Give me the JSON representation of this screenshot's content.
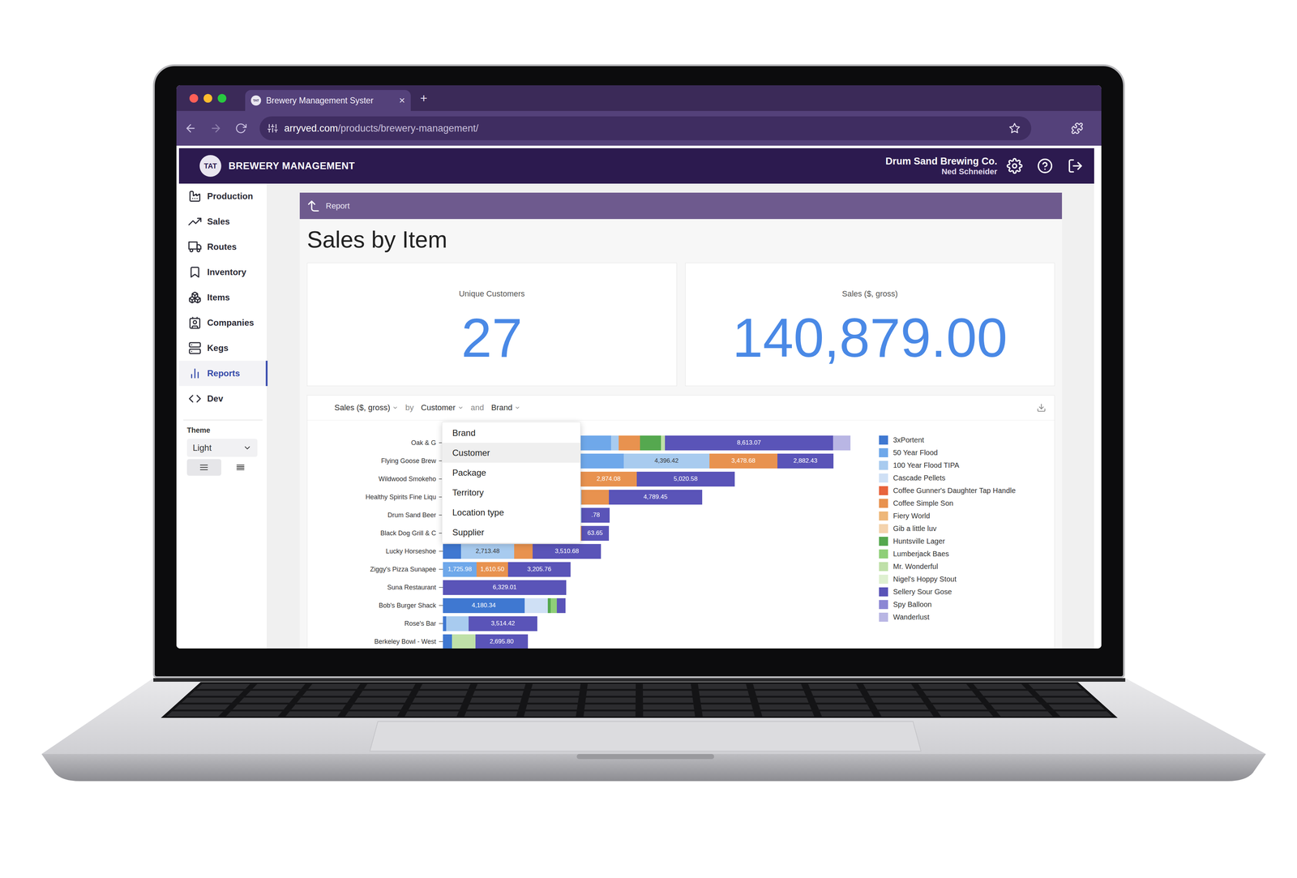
{
  "browser": {
    "tab": {
      "title": "Brewery Management Syster",
      "close": "×"
    },
    "new_tab": "+",
    "url": {
      "host": "arryved.com",
      "path": "/products/brewery-management/"
    }
  },
  "app": {
    "logo": "TAT",
    "name": "BREWERY MANAGEMENT",
    "company": "Drum Sand Brewing Co.",
    "user": "Ned Schneider"
  },
  "sidebar": {
    "items": [
      {
        "label": "Production",
        "selected": false
      },
      {
        "label": "Sales",
        "selected": false
      },
      {
        "label": "Routes",
        "selected": false
      },
      {
        "label": "Inventory",
        "selected": false
      },
      {
        "label": "Items",
        "selected": false
      },
      {
        "label": "Companies",
        "selected": false
      },
      {
        "label": "Kegs",
        "selected": false
      },
      {
        "label": "Reports",
        "selected": true
      },
      {
        "label": "Dev",
        "selected": false
      }
    ],
    "theme": {
      "label": "Theme",
      "value": "Light",
      "density": [
        {
          "kind": "comfortable",
          "selected": true
        },
        {
          "kind": "compact",
          "selected": false
        }
      ]
    }
  },
  "report": {
    "breadcrumb": "Report",
    "title": "Sales by Item",
    "stats": [
      {
        "label": "Unique Customers",
        "value": "27"
      },
      {
        "label": "Sales ($, gross)",
        "value": "140,879.00"
      }
    ]
  },
  "chart": {
    "toolbar": {
      "metric": "Sales ($, gross)",
      "by": "by",
      "group": "Customer",
      "and": "and",
      "subgroup": "Brand"
    },
    "menu": {
      "open": true,
      "options": [
        {
          "label": "Brand",
          "selected": false
        },
        {
          "label": "Customer",
          "selected": true
        },
        {
          "label": "Package",
          "selected": false
        },
        {
          "label": "Territory",
          "selected": false
        },
        {
          "label": "Location type",
          "selected": false
        },
        {
          "label": "Supplier",
          "selected": false
        }
      ]
    },
    "categories": [
      "Oak & G",
      "Flying Goose Brew",
      "Wildwood Smokeho",
      "Healthy Spirits Fine Liqu",
      "Drum Sand Beer",
      "Black Dog Grill & C",
      "Lucky Horseshoe",
      "Ziggy's Pizza Sunapee",
      "Suna Restaurant",
      "Bob's Burger Shack",
      "Rose's Bar",
      "Berkeley Bowl - West"
    ],
    "series": [
      {
        "name": "3xPortent",
        "color": "#3f78d1",
        "values": [
          4335,
          3060,
          2455,
          3000,
          2200,
          3100,
          935,
          0,
          0,
          4180.34,
          170,
          470
        ],
        "labels": [
          "",
          "",
          "",
          "",
          "",
          "",
          "",
          "",
          "",
          "4,180.34",
          "",
          ""
        ]
      },
      {
        "name": "50 Year Flood",
        "color": "#6fa8ea",
        "values": [
          4290,
          6205,
          4600,
          3500,
          2600,
          2500,
          0,
          1725.98,
          0,
          0,
          0,
          0
        ],
        "labels": [
          "",
          "",
          "",
          "",
          "",
          "",
          "",
          "1,725.98",
          "",
          "",
          "",
          ""
        ]
      },
      {
        "name": "100 Year Flood TIPA",
        "color": "#a8cbef",
        "values": [
          380,
          4396.42,
          0,
          600,
          2300,
          0,
          2713.48,
          0,
          0,
          0,
          1150,
          0
        ],
        "labels": [
          "",
          "4,396.42",
          "",
          "",
          "",
          "",
          "2,713.48",
          "",
          "",
          "",
          "",
          ""
        ]
      },
      {
        "name": "Cascade Pellets",
        "color": "#cfe0f5",
        "values": [
          0,
          0,
          0,
          0,
          0,
          0,
          0,
          0,
          0,
          1200,
          0,
          0
        ],
        "labels": [
          "",
          "",
          "",
          "",
          "",
          "",
          "",
          "",
          "",
          "",
          "",
          ""
        ]
      },
      {
        "name": "Coffee Gunner's Daughter Tap Handle",
        "color": "#e8643c",
        "values": [
          0,
          0,
          0,
          0,
          0,
          0,
          0,
          0,
          0,
          0,
          0,
          0
        ],
        "labels": [
          "",
          "",
          "",
          "",
          "",
          "",
          "",
          "",
          "",
          "",
          "",
          ""
        ]
      },
      {
        "name": "Coffee Simple Son",
        "color": "#e8924f",
        "values": [
          1105,
          3478.68,
          2874.08,
          1400,
          0,
          1500,
          950,
          1610.5,
          0,
          0,
          0,
          0
        ],
        "labels": [
          "",
          "3,478.68",
          "2,874.08",
          "",
          "",
          "",
          "",
          "1,610.50",
          "",
          "",
          "",
          ""
        ]
      },
      {
        "name": "Fiery World",
        "color": "#eeb779",
        "values": [
          0,
          0,
          0,
          0,
          0,
          0,
          0,
          0,
          0,
          0,
          0,
          0
        ],
        "labels": [
          "",
          "",
          "",
          "",
          "",
          "",
          "",
          "",
          "",
          "",
          "",
          ""
        ]
      },
      {
        "name": "Gib a little luv",
        "color": "#f4d3ad",
        "values": [
          0,
          0,
          0,
          0,
          0,
          0,
          0,
          0,
          0,
          0,
          0,
          0
        ],
        "labels": [
          "",
          "",
          "",
          "",
          "",
          "",
          "",
          "",
          "",
          "",
          "",
          ""
        ]
      },
      {
        "name": "Huntsville Lager",
        "color": "#55a84f",
        "values": [
          1060,
          0,
          0,
          0,
          0,
          0,
          0,
          0,
          0,
          150,
          0,
          0
        ],
        "labels": [
          "",
          "",
          "",
          "",
          "",
          "",
          "",
          "",
          "",
          "",
          "",
          ""
        ]
      },
      {
        "name": "Lumberjack Baes",
        "color": "#8fcf78",
        "values": [
          0,
          0,
          0,
          0,
          0,
          0,
          0,
          0,
          0,
          300,
          0,
          0
        ],
        "labels": [
          "",
          "",
          "",
          "",
          "",
          "",
          "",
          "",
          "",
          "",
          "",
          ""
        ]
      },
      {
        "name": "Mr. Wonderful",
        "color": "#bfe0a8",
        "values": [
          210,
          0,
          0,
          0,
          0,
          0,
          0,
          0,
          0,
          0,
          0,
          1190
        ],
        "labels": [
          "",
          "",
          "",
          "",
          "",
          "",
          "",
          "",
          "",
          "",
          "",
          ""
        ]
      },
      {
        "name": "Nigel's Hoppy Stout",
        "color": "#def0d0",
        "values": [
          0,
          0,
          0,
          0,
          0,
          0,
          0,
          0,
          0,
          0,
          0,
          0
        ],
        "labels": [
          "",
          "",
          "",
          "",
          "",
          "",
          "",
          "",
          "",
          "",
          "",
          ""
        ]
      },
      {
        "name": "Sellery Sour Gose",
        "color": "#5a54b8",
        "values": [
          8613.07,
          2882.43,
          5020.58,
          4789.45,
          1450,
          1400,
          3510.68,
          3205.76,
          6329.01,
          450,
          3514.42,
          2695.8
        ],
        "labels": [
          "8,613.07",
          "2,882.43",
          "5,020.58",
          "4,789.45",
          ".78",
          "63.65",
          "3,510.68",
          "3,205.76",
          "6,329.01",
          "",
          "3,514.42",
          "2,695.80"
        ]
      },
      {
        "name": "Spy Balloon",
        "color": "#8b86d4",
        "values": [
          0,
          0,
          0,
          0,
          0,
          0,
          0,
          0,
          0,
          0,
          0,
          0
        ],
        "labels": [
          "",
          "",
          "",
          "",
          "",
          "",
          "",
          "",
          "",
          "",
          "",
          ""
        ]
      },
      {
        "name": "Wanderlust",
        "color": "#b9b6e4",
        "values": [
          890,
          0,
          0,
          0,
          0,
          0,
          0,
          0,
          0,
          0,
          0,
          0
        ],
        "labels": [
          "",
          "",
          "",
          "",
          "",
          "",
          "",
          "",
          "",
          "",
          "",
          ""
        ]
      }
    ]
  }
}
